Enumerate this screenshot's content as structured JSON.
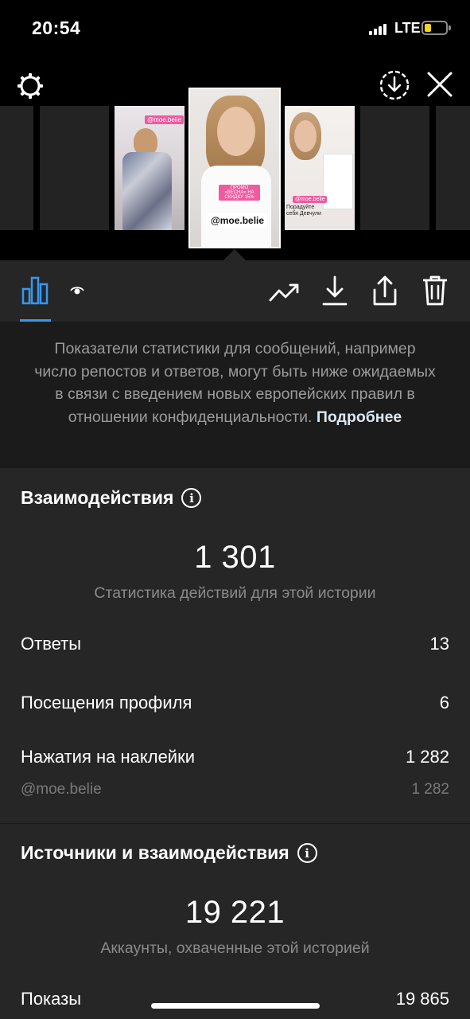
{
  "status_bar": {
    "time": "20:54",
    "network": "LTE",
    "battery_color": "#f4d21f"
  },
  "top_controls": {
    "settings_icon": "gear-icon",
    "download_all_icon": "download-circle-icon",
    "close_icon": "close-icon"
  },
  "thumbnails": {
    "items": [
      {
        "tag": "@moe.belie"
      },
      {
        "tag": "ПРОМО «ВЕСНА» НА СКИДКУ 15%",
        "handle": "@moe.belie"
      },
      {
        "tag": "@moe.belie",
        "caption": "Порадуйте себя Девчули"
      }
    ]
  },
  "toolbar": {
    "tabs": [
      {
        "name": "insights",
        "icon": "bar-chart-icon",
        "active": true
      },
      {
        "name": "viewers",
        "icon": "eye-icon",
        "active": false
      }
    ],
    "actions": [
      "promote-icon",
      "download-icon",
      "share-icon",
      "trash-icon"
    ],
    "accent": "#3797f0"
  },
  "notice": {
    "text": "Показатели статистики для сообщений, например число репостов и ответов, могут быть ниже ожидаемых в связи с введением новых европейских правил в отношении конфиденциальности.",
    "link": "Подробнее"
  },
  "interactions": {
    "title": "Взаимодействия",
    "total": "1 301",
    "caption": "Статистика действий для этой истории",
    "rows": [
      {
        "label": "Ответы",
        "value": "13"
      },
      {
        "label": "Посещения профиля",
        "value": "6"
      },
      {
        "label": "Нажатия на наклейки",
        "value": "1 282"
      }
    ],
    "sub_row": {
      "label": "@moe.belie",
      "value": "1 282"
    }
  },
  "discovery": {
    "title": "Источники и взаимодействия",
    "total": "19 221",
    "caption": "Аккаунты, охваченные этой историей",
    "rows": [
      {
        "label": "Показы",
        "value": "19 865"
      }
    ]
  }
}
